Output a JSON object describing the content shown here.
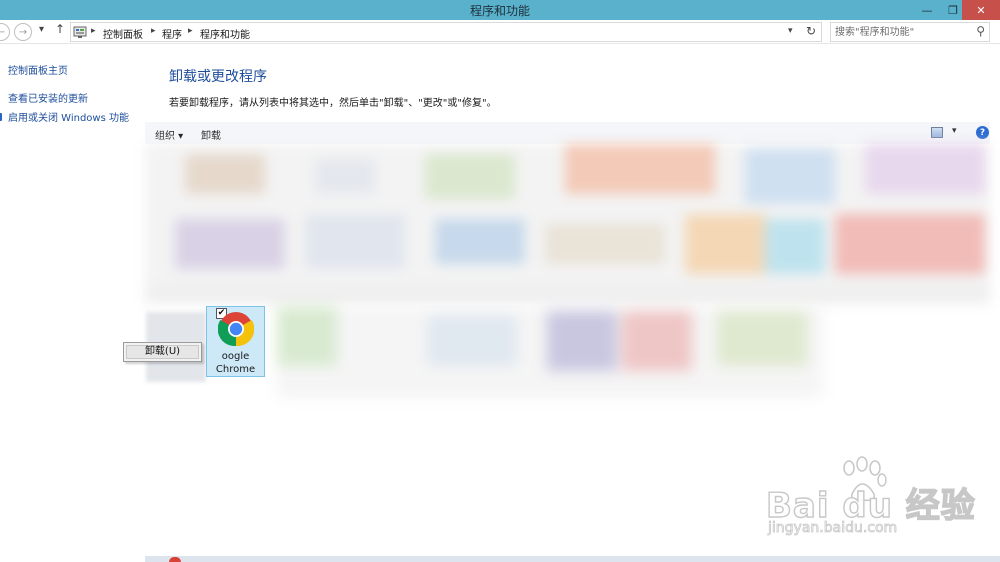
{
  "window": {
    "title": "程序和功能",
    "min_symbol": "—",
    "max_symbol": "❐",
    "close_symbol": "✕"
  },
  "nav": {
    "back_symbol": "←",
    "forward_symbol": "→",
    "recent_symbol": "▾",
    "up_symbol": "↑",
    "breadcrumbs": [
      "控制面板",
      "程序",
      "程序和功能"
    ],
    "separator": "▸",
    "dropdown_symbol": "▾",
    "refresh_symbol": "↻",
    "search_placeholder": "搜索\"程序和功能\"",
    "search_symbol": "⚲"
  },
  "sidebar": {
    "items": [
      {
        "label": "控制面板主页"
      },
      {
        "label": "查看已安装的更新"
      },
      {
        "label": "启用或关闭 Windows 功能"
      }
    ]
  },
  "main": {
    "title": "卸载或更改程序",
    "description": "若要卸载程序，请从列表中将其选中，然后单击\"卸载\"、\"更改\"或\"修复\"。",
    "toolbar": {
      "organize_label": "组织 ▾",
      "uninstall_label": "卸载",
      "view_dropdown": "▾",
      "help_label": "?"
    },
    "selected_program": {
      "name_line1": "oogle",
      "name_line2": "Chrome",
      "checked_symbol": "✔"
    },
    "context_menu": {
      "items": [
        {
          "label": "卸载(U)"
        }
      ]
    }
  },
  "watermark": {
    "brand": "Bai  du 经验",
    "url": "jingyan.baidu.com"
  },
  "colors": {
    "titlebar": "#5ab1cc",
    "close_button": "#c7504a",
    "link_blue": "#1e4e9c",
    "selection": "#cde8f7"
  }
}
